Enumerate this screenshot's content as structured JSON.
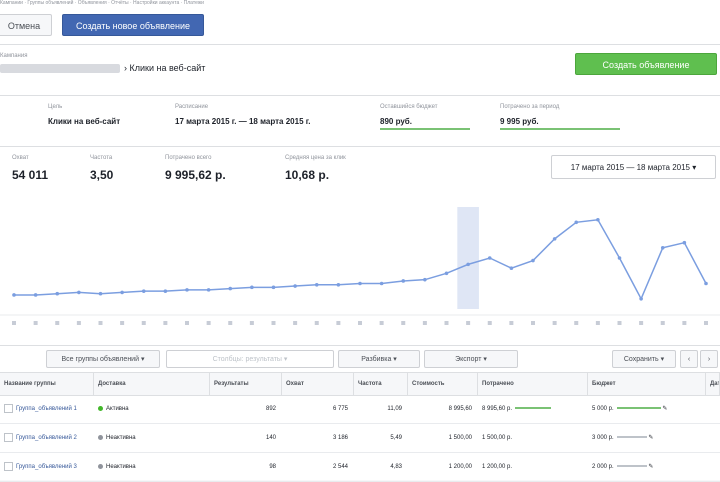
{
  "topbar": {
    "hint_text": "Кампании · Группы объявлений · Объявления · Отчёты · Настройки аккаунта · Платежи",
    "cancel_label": "Отмена",
    "create_label": "Создать новое объявление"
  },
  "header": {
    "small_label": "Кампания",
    "breadcrumb_suffix": "› Клики на веб-сайт",
    "green_button_label": "Создать объявление"
  },
  "filters": {
    "objective": {
      "label": "Цель",
      "value": "Клики на веб-сайт"
    },
    "dates": {
      "label": "Расписание",
      "value": "17 марта 2015 г. — 18 марта 2015 г."
    },
    "budget": {
      "label": "Оставшийся бюджет",
      "value": "890 руб."
    },
    "spent": {
      "label": "Потрачено за период",
      "value": "9 995 руб."
    }
  },
  "stats": [
    {
      "label": "Охват",
      "value": "54 011"
    },
    {
      "label": "Частота",
      "value": "3,50"
    },
    {
      "label": "Потрачено всего",
      "value": "9 995,62 р."
    },
    {
      "label": "Средняя цена за клик",
      "value": "10,68 р."
    }
  ],
  "date_range": "17 марта 2015 — 18 марта 2015 ▾",
  "chart_data": {
    "type": "line",
    "values": [
      11,
      11,
      12,
      13,
      12,
      13,
      14,
      14,
      15,
      15,
      16,
      17,
      17,
      18,
      19,
      19,
      20,
      20,
      22,
      23,
      28,
      35,
      40,
      32,
      38,
      55,
      68,
      70,
      40,
      8,
      48,
      52,
      20
    ],
    "highlight_index": 21,
    "color": "#7b9ee0",
    "grid": false
  },
  "toolbar": {
    "view_label": "Все группы объявлений ▾",
    "columns_label": "Столбцы: результаты ▾",
    "breakdown_label": "Разбивка ▾",
    "export_label": "Экспорт ▾",
    "right_label": "Сохранить ▾"
  },
  "table": {
    "headers": [
      "Название группы",
      "Доставка",
      "Результаты",
      "Охват",
      "Частота",
      "Стоимость",
      "Потрачено",
      "Бюджет",
      "Дата окончания"
    ],
    "rows": [
      {
        "name": "Группа_объявлений 1",
        "status": "Активна",
        "status_color": "#42b72a",
        "results": "892",
        "reach": "6 775",
        "freq": "11,09",
        "cost": "8 995,60",
        "spent": "8 995,60 р.",
        "budget": "5 000 р."
      },
      {
        "name": "Группа_объявлений 2",
        "status": "Неактивна",
        "status_color": "#90949c",
        "results": "140",
        "reach": "3 186",
        "freq": "5,49",
        "cost": "1 500,00",
        "spent": "1 500,00 р.",
        "budget": "3 000 р."
      },
      {
        "name": "Группа_объявлений 3",
        "status": "Неактивна",
        "status_color": "#90949c",
        "results": "98",
        "reach": "2 544",
        "freq": "4,83",
        "cost": "1 200,00",
        "spent": "1 200,00 р.",
        "budget": "2 000 р."
      }
    ]
  }
}
